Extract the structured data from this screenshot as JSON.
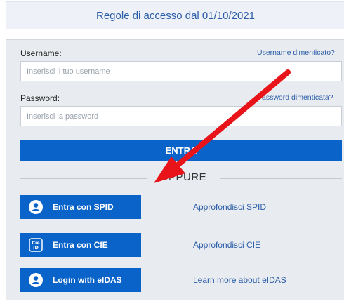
{
  "banner": {
    "text": "Regole di accesso dal 01/10/2021"
  },
  "login": {
    "username_label": "Username:",
    "username_forgot": "Username dimenticato?",
    "username_placeholder": "Inserisci il tuo username",
    "password_label": "Password:",
    "password_forgot": "Password dimenticata?",
    "password_placeholder": "Inserisci la password",
    "enter_label": "ENTRA"
  },
  "separator": {
    "text": "OPPURE"
  },
  "auth": [
    {
      "button": "Entra con SPID",
      "icon": "user-icon",
      "link": "Approfondisci SPID"
    },
    {
      "button": "Entra con CIE",
      "icon": "cie-id-icon",
      "link": "Approfondisci CIE"
    },
    {
      "button": "Login with eIDAS",
      "icon": "user-icon",
      "link": "Learn more about eIDAS"
    }
  ],
  "annotation": {
    "color": "#e8141a",
    "icon": "red-arrow"
  },
  "colors": {
    "primary": "#0a63c8",
    "link": "#2b5da8",
    "panel": "#e8ebf0"
  }
}
